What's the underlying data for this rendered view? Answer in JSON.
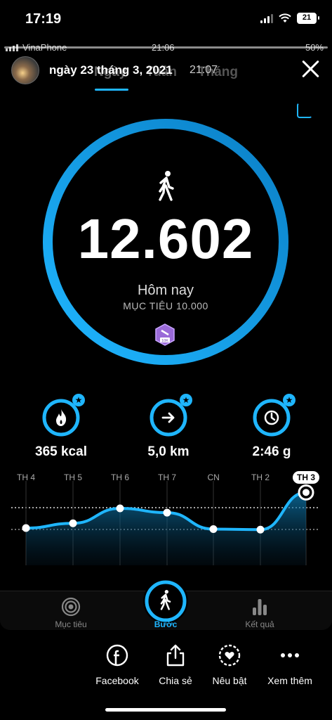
{
  "ios_status": {
    "time": "17:19",
    "battery": "21"
  },
  "inner_status": {
    "carrier": "VinaPhone",
    "time": "21:06",
    "battery": "50%"
  },
  "story": {
    "user": "ngày 23 tháng 3, 2021",
    "time": "21:07"
  },
  "tabs": [
    {
      "label": "Ngày"
    },
    {
      "label": "Tuần"
    },
    {
      "label": "Tháng"
    }
  ],
  "summary": {
    "steps": "12.602",
    "period": "Hôm nay",
    "goal": "MỤC TIÊU 10.000",
    "badge": "10K",
    "progress": 1.0
  },
  "metrics": [
    {
      "icon": "flame-icon",
      "value": "365 kcal"
    },
    {
      "icon": "arrow-right-icon",
      "value": "5,0 km"
    },
    {
      "icon": "clock-icon",
      "value": "2:46 g"
    }
  ],
  "chart_data": {
    "type": "area",
    "categories": [
      "TH 4",
      "TH 5",
      "TH 6",
      "TH 7",
      "CN",
      "TH 2",
      "TH 3"
    ],
    "values": [
      0.33,
      0.42,
      0.7,
      0.62,
      0.31,
      0.3,
      1.0
    ],
    "selected": "TH 3"
  },
  "app_nav": [
    {
      "label": "Mục tiêu"
    },
    {
      "label": "Bước"
    },
    {
      "label": "Kết quả"
    }
  ],
  "actions": [
    {
      "label": "Facebook"
    },
    {
      "label": "Chia sẻ"
    },
    {
      "label": "Nêu bật"
    },
    {
      "label": "Xem thêm"
    }
  ],
  "colors": {
    "accent": "#1fb6ff",
    "accent_dark": "#0b6fa8"
  }
}
